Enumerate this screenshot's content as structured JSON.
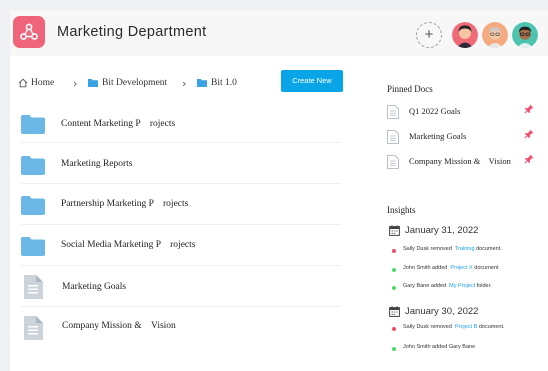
{
  "header": {
    "title": "Marketing Department",
    "add_label": "+",
    "logo_color": "#f0647a"
  },
  "breadcrumb": {
    "home": "Home",
    "items": [
      "Bit Development",
      "Bit 1.0"
    ],
    "folder_color": "#3aa3e3"
  },
  "actions": {
    "create_new": "Create New",
    "accent": "#0aa5e6"
  },
  "files": [
    {
      "name": "Content Marketing P    rojects",
      "icon": "folder-icon"
    },
    {
      "name": "Marketing Reports",
      "icon": "folder-icon"
    },
    {
      "name": "Partnership Marketing P    rojects",
      "icon": "folder-icon"
    },
    {
      "name": "Social Media Marketing P    rojects",
      "icon": "folder-icon"
    },
    {
      "name": "Marketing Goals",
      "icon": "document-icon"
    },
    {
      "name": "Company Mission &    Vision",
      "icon": "document-icon"
    }
  ],
  "pinned": {
    "title": "Pinned Docs",
    "items": [
      {
        "name": "Q1 2022 Goals"
      },
      {
        "name": "Marketing Goals"
      },
      {
        "name": "Company Mission &    Vision"
      }
    ],
    "pin_color": "#f0506e"
  },
  "insights": {
    "title": "Insights",
    "groups": [
      {
        "date": "January 31, 2022",
        "items": [
          {
            "pre": "Sally Dusk removed  ",
            "hl": "Training",
            "post": " document.",
            "dot": "#f0506e"
          },
          {
            "pre": "John Smith added  ",
            "hl": "Project X",
            "post": " document",
            "dot": "#4cd964"
          },
          {
            "pre": "Gary Bane added  ",
            "hl": "My Project",
            "post": " folder.",
            "dot": "#4cd964"
          }
        ]
      },
      {
        "date": "January 30, 2022",
        "items": [
          {
            "pre": "Sally Dusk removed  ",
            "hl": "Project B",
            "post": " document.",
            "dot": "#f0506e"
          },
          {
            "pre": "John Smith added Gary Bane",
            "hl": "",
            "post": "",
            "dot": "#4cd964"
          }
        ]
      }
    ]
  }
}
